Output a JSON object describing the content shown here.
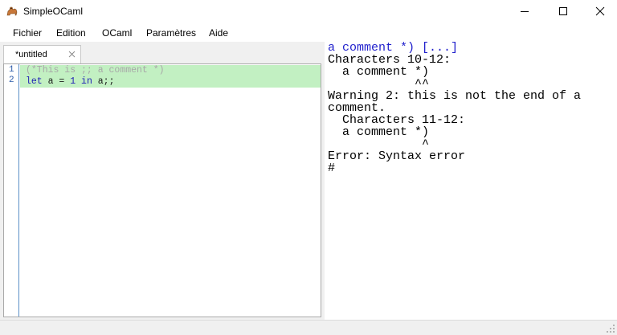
{
  "window": {
    "title": "SimpleOCaml",
    "icon": "camel-icon",
    "controls": [
      "minimize-icon",
      "maximize-icon",
      "close-icon"
    ]
  },
  "menu": {
    "items": [
      "Fichier",
      "Edition",
      "OCaml",
      "Paramètres",
      "Aide"
    ]
  },
  "editor": {
    "tab_label": "*untitled",
    "line_numbers": [
      "1",
      "2"
    ],
    "lines": [
      {
        "tokens": [
          {
            "t": "(*This is ;; a comment *)",
            "k": "comment"
          }
        ]
      },
      {
        "tokens": [
          {
            "t": "let",
            "k": "kw"
          },
          {
            "t": " a = ",
            "k": "id"
          },
          {
            "t": "1",
            "k": "num"
          },
          {
            "t": " ",
            "k": "id"
          },
          {
            "t": "in",
            "k": "kw"
          },
          {
            "t": " a;;",
            "k": "id"
          }
        ]
      }
    ],
    "highlight_color": "#c2f0c2"
  },
  "output": {
    "lines": [
      {
        "text": "a comment *) [...]",
        "style": "blue"
      },
      {
        "text": "Characters 10-12:",
        "style": "normal"
      },
      {
        "text": "  a comment *)",
        "style": "normal"
      },
      {
        "text": "            ^^",
        "style": "normal"
      },
      {
        "text": "Warning 2: this is not the end of a",
        "style": "normal"
      },
      {
        "text": "comment.",
        "style": "normal"
      },
      {
        "text": "  Characters 11-12:",
        "style": "normal"
      },
      {
        "text": "  a comment *)",
        "style": "normal"
      },
      {
        "text": "             ^",
        "style": "normal"
      },
      {
        "text": "Error: Syntax error",
        "style": "normal"
      },
      {
        "text": "#",
        "style": "normal"
      }
    ]
  },
  "colors": {
    "output_echo": "#1f1fcc",
    "keyword": "#1f1fb5",
    "comment": "#a8a8a8"
  }
}
